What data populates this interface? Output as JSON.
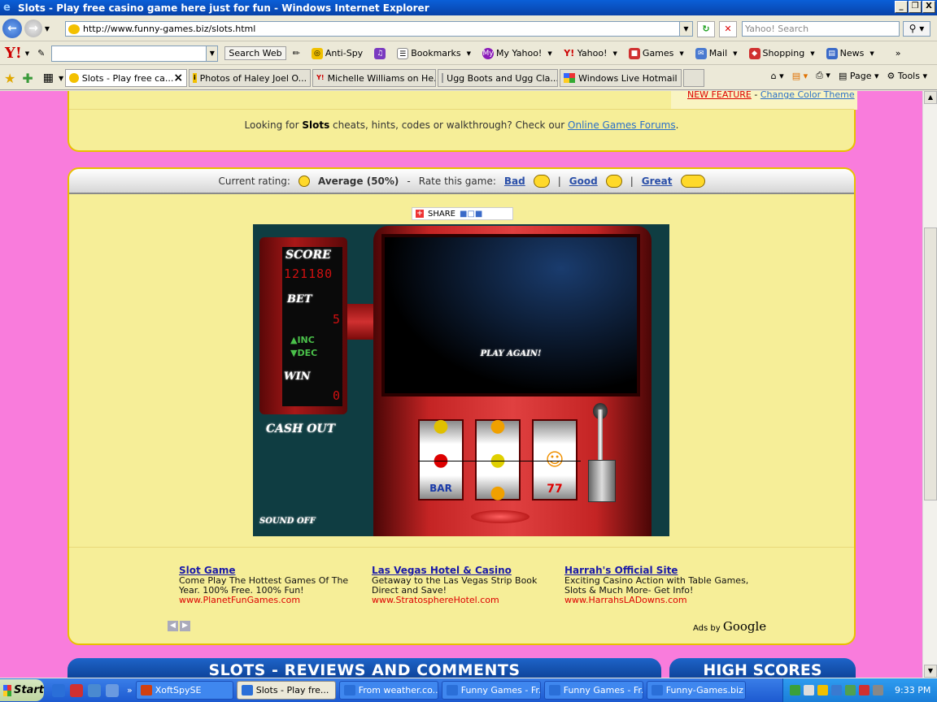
{
  "window": {
    "title": "Slots - Play free casino game here just for fun - Windows Internet Explorer",
    "controls": [
      "_",
      "❐",
      "X"
    ]
  },
  "address": {
    "url": "http://www.funny-games.biz/slots.html",
    "search_placeholder": "Yahoo! Search"
  },
  "yahoo_toolbar": {
    "logo": "Y!",
    "search_web": "Search Web",
    "anti_spy": "Anti-Spy",
    "bookmarks": "Bookmarks",
    "my_yahoo": "My Yahoo!",
    "yahoo": "Yahoo!",
    "games": "Games",
    "mail": "Mail",
    "shopping": "Shopping",
    "news": "News"
  },
  "tabs": [
    {
      "label": "Slots - Play free ca...",
      "active": true
    },
    {
      "label": "Photos of Haley Joel O..."
    },
    {
      "label": "Michelle Williams on He..."
    },
    {
      "label": "Ugg Boots and Ugg Cla..."
    },
    {
      "label": "Windows Live Hotmail"
    }
  ],
  "tab_close": "×",
  "command_bar": {
    "page": "Page",
    "tools": "Tools"
  },
  "feature": {
    "new_feature": "NEW FEATURE",
    "sep": " - ",
    "change_theme": "Change Color Theme"
  },
  "forum": {
    "prefix": "Looking for ",
    "game": "Slots",
    "middle": " cheats, hints, codes or walkthrough? Check our ",
    "link": "Online Games Forums",
    "suffix": "."
  },
  "rating": {
    "current_label": "Current rating:",
    "current_value": "Average (50%)",
    "dash": "-",
    "rate_label": "Rate this game:",
    "bad": "Bad",
    "good": "Good",
    "great": "Great",
    "sep": "|"
  },
  "share": {
    "label": "SHARE"
  },
  "game": {
    "score_label": "SCORE",
    "score_value": "121180",
    "bet_label": "BET",
    "bet_value": "5",
    "inc_label": "INC",
    "dec_label": "DEC",
    "win_label": "WIN",
    "win_value": "0",
    "cash_out": "CASH OUT",
    "play_again": "PLAY AGAIN!",
    "sound_off": "SOUND OFF"
  },
  "ads": [
    {
      "title": "Slot Game",
      "desc": "Come Play The Hottest Games Of The Year. 100% Free. 100% Fun!",
      "url": "www.PlanetFunGames.com"
    },
    {
      "title": "Las Vegas Hotel & Casino",
      "desc": "Getaway to the Las Vegas Strip Book Direct and Save!",
      "url": "www.StratosphereHotel.com"
    },
    {
      "title": "Harrah's Official Site",
      "desc": "Exciting Casino Action with Table Games, Slots & Much More- Get Info!",
      "url": "www.HarrahsLADowns.com"
    }
  ],
  "ads_by": {
    "prefix": "Ads by ",
    "brand": "Google"
  },
  "sections": {
    "reviews": "SLOTS - REVIEWS AND COMMENTS",
    "high_scores": "HIGH SCORES"
  },
  "taskbar": {
    "start": "Start",
    "tasks": [
      {
        "label": "XoftSpySE"
      },
      {
        "label": "Slots - Play fre...",
        "active": true
      },
      {
        "label": "From weather.co..."
      },
      {
        "label": "Funny Games - Fr..."
      },
      {
        "label": "Funny Games - Fr..."
      },
      {
        "label": "Funny-Games.biz ..."
      }
    ],
    "clock": "9:33 PM"
  }
}
